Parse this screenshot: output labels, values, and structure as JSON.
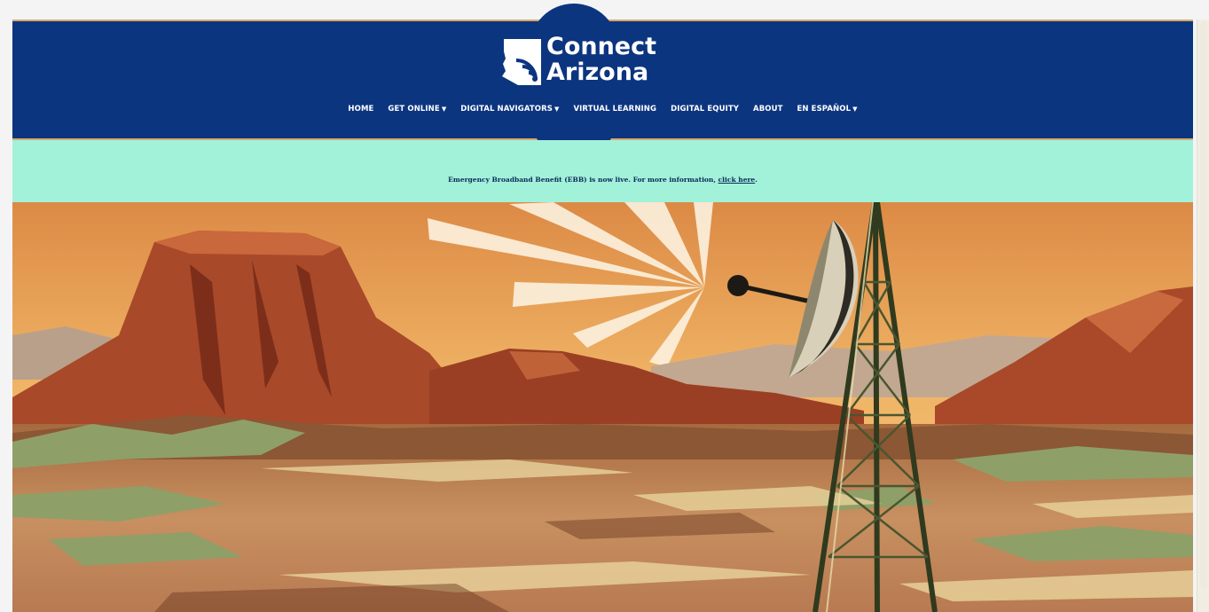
{
  "logo": {
    "line1": "Connect",
    "line2": "Arizona"
  },
  "nav": {
    "home": "HOME",
    "get_online": "GET ONLINE",
    "digital_navigators": "DIGITAL NAVIGATORS",
    "virtual_learning": "VIRTUAL LEARNING",
    "digital_equity": "DIGITAL EQUITY",
    "about": "ABOUT",
    "espanol": "EN ESPAÑOL",
    "caret": "▼"
  },
  "banner": {
    "text_before": "Emergency Broadband Benefit (EBB) is now live. For more information, ",
    "link": "click here",
    "text_after": "."
  },
  "colors": {
    "header_bg": "#0c3580",
    "banner_bg": "#a2f1d9",
    "accent_border": "#d9a86c"
  },
  "hero": {
    "icon": "desert-illustration-with-satellite-tower"
  }
}
